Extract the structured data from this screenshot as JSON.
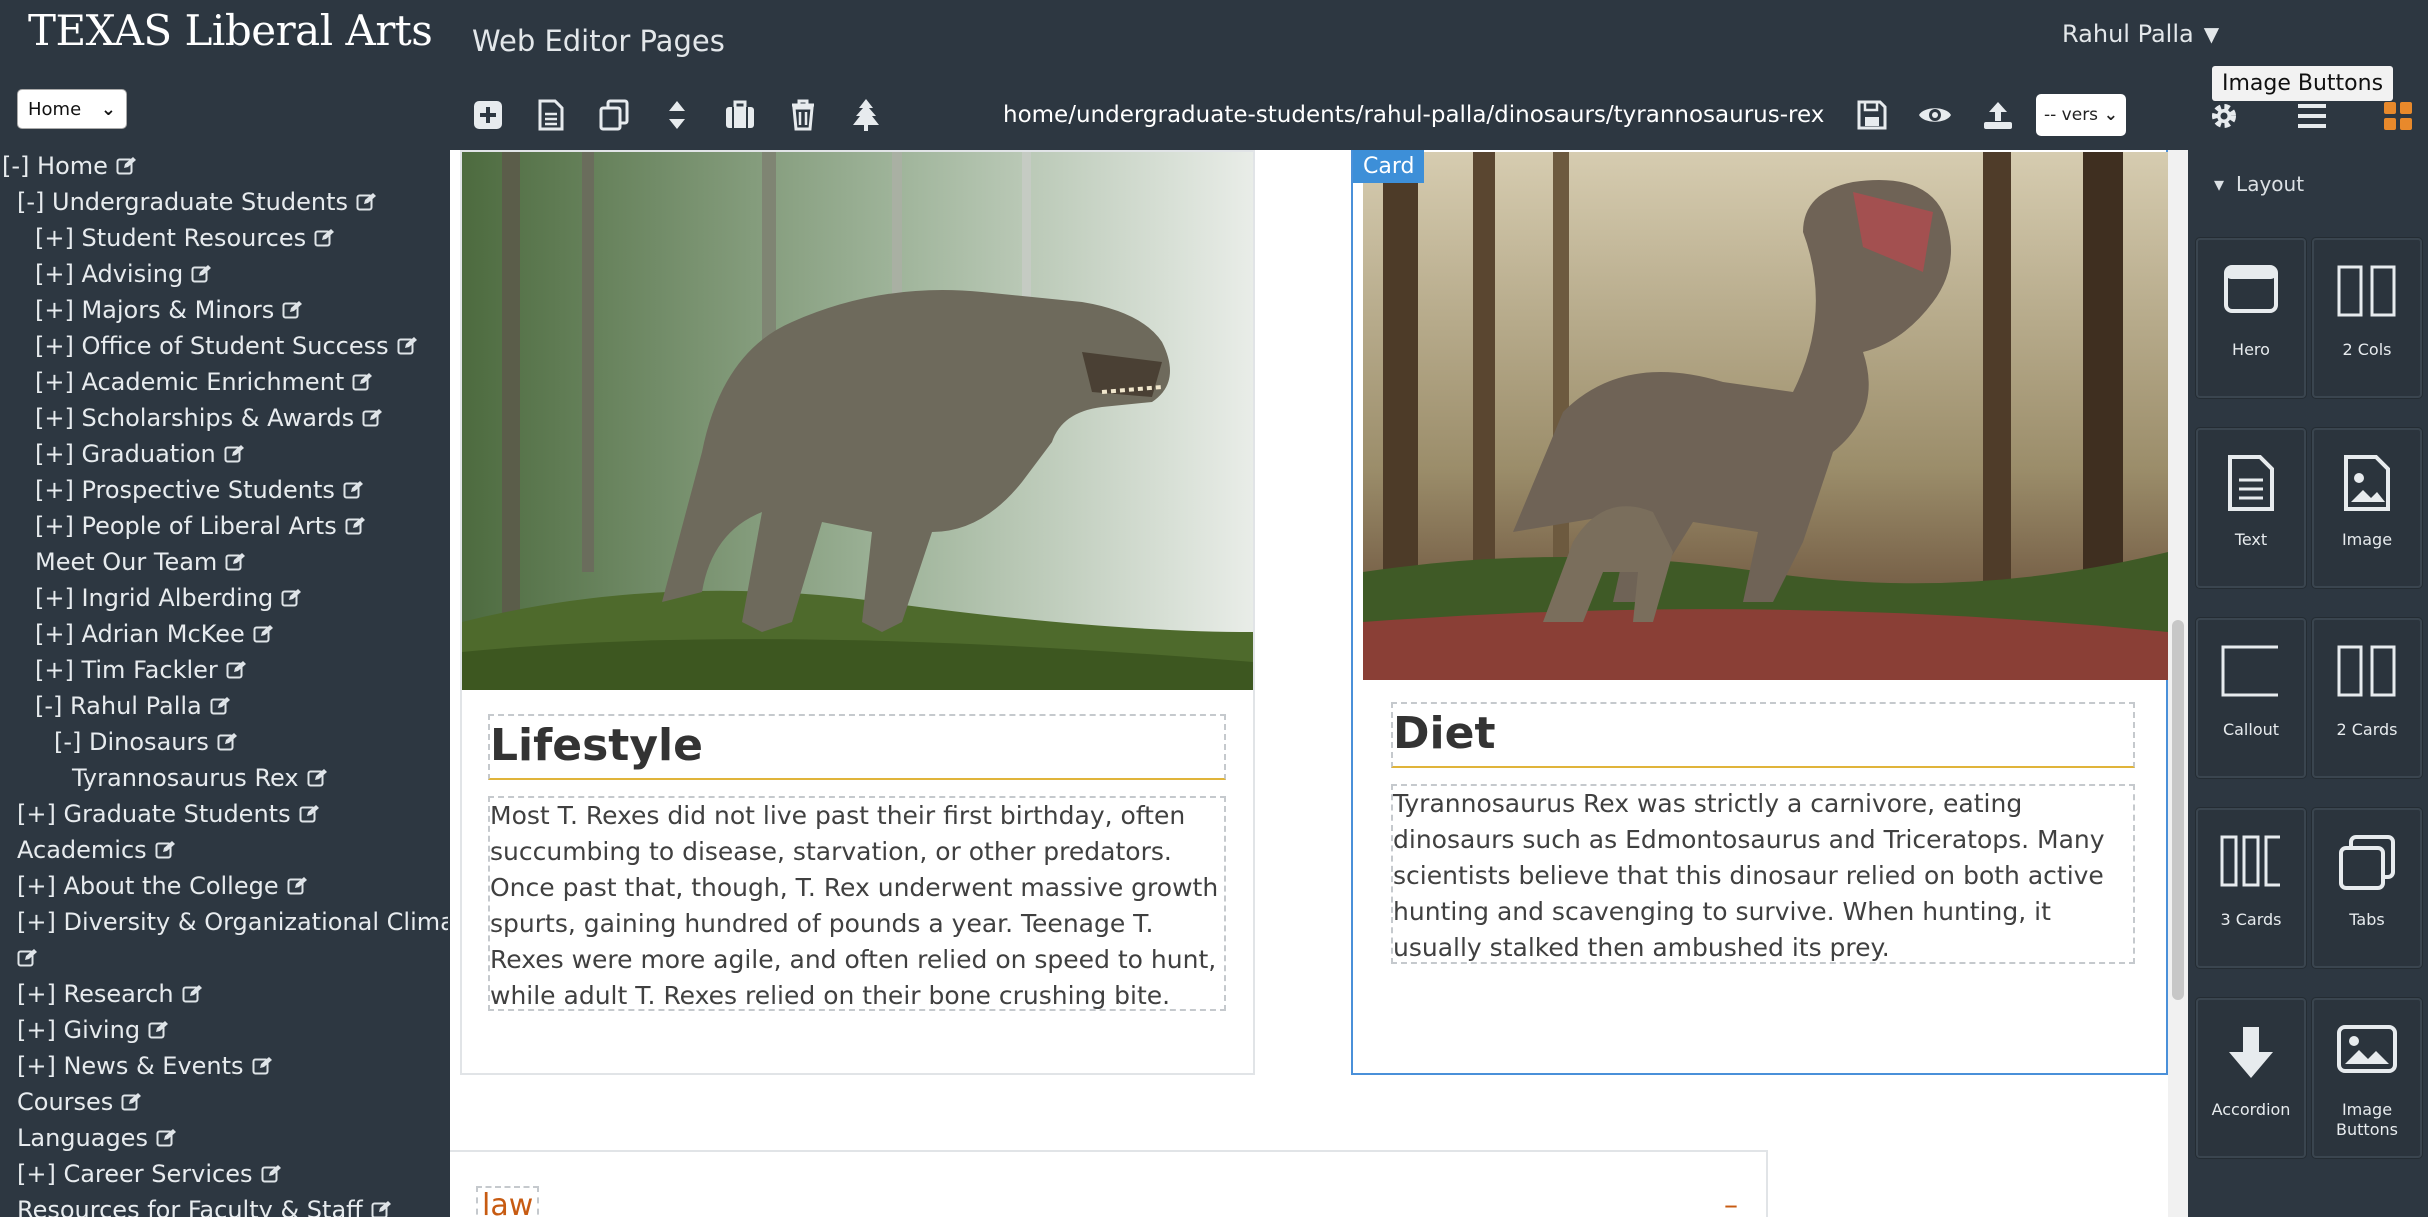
{
  "header": {
    "brand": "TEXAS Liberal Arts",
    "app_title": "Web Editor Pages",
    "user_name": "Rahul Palla"
  },
  "sidebar": {
    "site_select": "Home",
    "tree": [
      {
        "label": "[-] Home",
        "indent": 0
      },
      {
        "label": "[-] Undergraduate Students",
        "indent": 1
      },
      {
        "label": "[+] Student Resources",
        "indent": 2
      },
      {
        "label": "[+] Advising",
        "indent": 2
      },
      {
        "label": "[+] Majors & Minors",
        "indent": 2
      },
      {
        "label": "[+] Office of Student Success",
        "indent": 2
      },
      {
        "label": "[+] Academic Enrichment",
        "indent": 2
      },
      {
        "label": "[+] Scholarships & Awards",
        "indent": 2
      },
      {
        "label": "[+] Graduation",
        "indent": 2
      },
      {
        "label": "[+] Prospective Students",
        "indent": 2
      },
      {
        "label": "[+] People of Liberal Arts",
        "indent": 2
      },
      {
        "label": "Meet Our Team",
        "indent": 2
      },
      {
        "label": "[+] Ingrid Alberding",
        "indent": 2
      },
      {
        "label": "[+] Adrian McKee",
        "indent": 2
      },
      {
        "label": "[+] Tim Fackler",
        "indent": 2
      },
      {
        "label": "[-] Rahul Palla",
        "indent": 2
      },
      {
        "label": "[-] Dinosaurs",
        "indent": 3
      },
      {
        "label": "Tyrannosaurus Rex",
        "indent": 4
      },
      {
        "label": "[+] Graduate Students",
        "indent": 1
      },
      {
        "label": "Academics",
        "indent": 1
      },
      {
        "label": "[+] About the College",
        "indent": 1
      },
      {
        "label": "[+] Diversity & Organizational Climate",
        "indent": 1,
        "wrap": true
      },
      {
        "label": "[+] Research",
        "indent": 1
      },
      {
        "label": "[+] Giving",
        "indent": 1
      },
      {
        "label": "[+] News & Events",
        "indent": 1
      },
      {
        "label": "Courses",
        "indent": 1
      },
      {
        "label": "Languages",
        "indent": 1
      },
      {
        "label": "[+] Career Services",
        "indent": 1
      },
      {
        "label": "Resources for Faculty & Staff",
        "indent": 1
      }
    ]
  },
  "toolbar": {
    "path": "home/undergraduate-students/rahul-palla/dinosaurs/tyrannosaurus-rex",
    "version_select": "-- vers",
    "icons": [
      "add-icon",
      "page-icon",
      "copy-icon",
      "move-icon",
      "paste-icon",
      "delete-icon",
      "tree-icon",
      "save-icon",
      "preview-icon",
      "publish-icon"
    ]
  },
  "canvas": {
    "card_left": {
      "heading": "Lifestyle",
      "body": "Most T. Rexes did not live past their first birthday, often succumbing to disease, starvation, or other predators. Once past that, though, T. Rex underwent massive growth spurts, gaining hundred of pounds a year. Teenage T. Rexes were more agile, and often relied on speed to hunt, while adult T. Rexes relied on their bone crushing bite."
    },
    "card_right": {
      "tag": "Card",
      "heading": "Diet",
      "body": "Tyrannosaurus Rex was strictly a carnivore, eating dinosaurs such as Edmontosaurus and Triceratops. Many scientists believe that this dinosaur relied on both active hunting and scavenging to survive. When hunting, it usually stalked then ambushed its prey."
    },
    "accordion": {
      "title": "law",
      "toggle": "–"
    }
  },
  "right_panel": {
    "tooltip": "Image Buttons",
    "section": "Layout",
    "tabs": [
      "settings-icon",
      "list-icon",
      "components-icon"
    ],
    "components": [
      {
        "label": "Hero",
        "icon": "hero-icon"
      },
      {
        "label": "2 Cols",
        "icon": "two-cols-icon"
      },
      {
        "label": "Text",
        "icon": "text-icon"
      },
      {
        "label": "Image",
        "icon": "image-icon"
      },
      {
        "label": "Callout",
        "icon": "callout-icon"
      },
      {
        "label": "2 Cards",
        "icon": "two-cards-icon"
      },
      {
        "label": "3 Cards",
        "icon": "three-cards-icon"
      },
      {
        "label": "Tabs",
        "icon": "tabs-icon"
      },
      {
        "label": "Accordion",
        "icon": "accordion-icon"
      },
      {
        "label": "Image Buttons",
        "icon": "image-buttons-icon"
      }
    ]
  },
  "colors": {
    "chrome": "#2d3741",
    "accent_blue": "#3d8fd8",
    "burnt_orange": "#c75b12",
    "underline_gold": "#e0b43a"
  }
}
